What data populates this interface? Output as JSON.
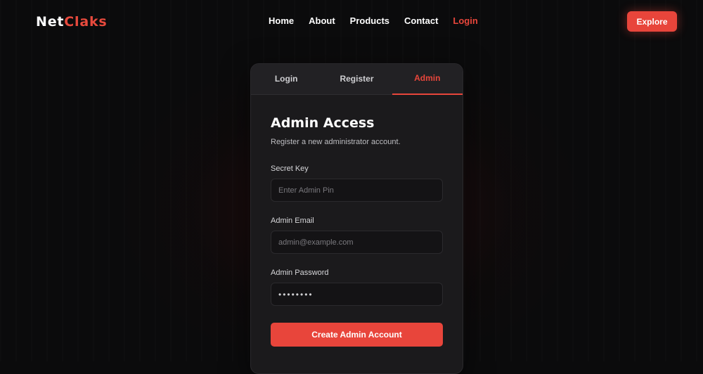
{
  "brand": {
    "logo_part1": "Net",
    "logo_part2": "Claks",
    "accent_color": "#e8453b"
  },
  "nav": {
    "links": [
      {
        "label": "Home",
        "active": false
      },
      {
        "label": "About",
        "active": false
      },
      {
        "label": "Products",
        "active": false
      },
      {
        "label": "Contact",
        "active": false
      },
      {
        "label": "Login",
        "active": true
      }
    ],
    "explore_label": "Explore"
  },
  "auth": {
    "tabs": [
      {
        "label": "Login",
        "active": false
      },
      {
        "label": "Register",
        "active": false
      },
      {
        "label": "Admin",
        "active": true
      }
    ],
    "title": "Admin Access",
    "subtitle": "Register a new administrator account.",
    "fields": {
      "secret_key": {
        "label": "Secret Key",
        "placeholder": "Enter Admin Pin",
        "value": ""
      },
      "email": {
        "label": "Admin Email",
        "placeholder": "admin@example.com",
        "value": ""
      },
      "password": {
        "label": "Admin Password",
        "placeholder": "",
        "value": "••••••••"
      }
    },
    "submit_label": "Create Admin Account"
  }
}
